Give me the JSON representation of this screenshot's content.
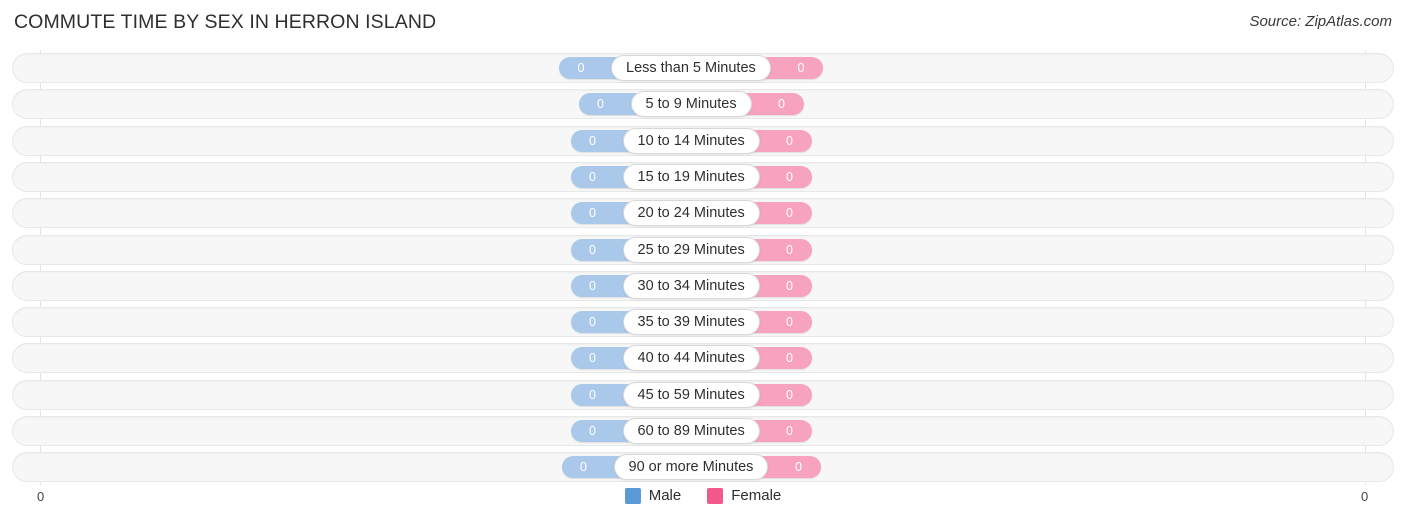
{
  "header": {
    "title": "COMMUTE TIME BY SEX IN HERRON ISLAND",
    "source": "Source: ZipAtlas.com"
  },
  "legend": {
    "male_label": "Male",
    "female_label": "Female",
    "male_color": "#5b9bd5",
    "female_color": "#f2588a"
  },
  "axis": {
    "left_tick": "0",
    "right_tick": "0"
  },
  "chart_data": {
    "type": "bar",
    "title": "COMMUTE TIME BY SEX IN HERRON ISLAND",
    "subtitle": "Source: ZipAtlas.com",
    "orientation": "horizontal-diverging",
    "xlabel": "",
    "ylabel": "",
    "xlim": [
      0,
      0
    ],
    "grid": true,
    "legend_position": "bottom-center",
    "categories": [
      "Less than 5 Minutes",
      "5 to 9 Minutes",
      "10 to 14 Minutes",
      "15 to 19 Minutes",
      "20 to 24 Minutes",
      "25 to 29 Minutes",
      "30 to 34 Minutes",
      "35 to 39 Minutes",
      "40 to 44 Minutes",
      "45 to 59 Minutes",
      "60 to 89 Minutes",
      "90 or more Minutes"
    ],
    "series": [
      {
        "name": "Male",
        "color": "#a9c8ea",
        "values": [
          0,
          0,
          0,
          0,
          0,
          0,
          0,
          0,
          0,
          0,
          0,
          0
        ],
        "labels": [
          "0",
          "0",
          "0",
          "0",
          "0",
          "0",
          "0",
          "0",
          "0",
          "0",
          "0",
          "0"
        ]
      },
      {
        "name": "Female",
        "color": "#f7a3bf",
        "values": [
          0,
          0,
          0,
          0,
          0,
          0,
          0,
          0,
          0,
          0,
          0,
          0
        ],
        "labels": [
          "0",
          "0",
          "0",
          "0",
          "0",
          "0",
          "0",
          "0",
          "0",
          "0",
          "0",
          "0"
        ]
      }
    ]
  }
}
